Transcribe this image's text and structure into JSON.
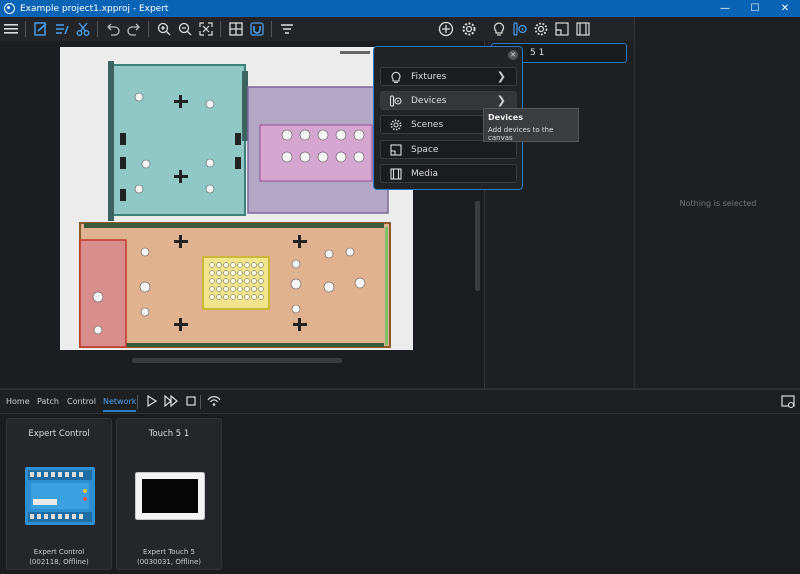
{
  "window": {
    "title": "Example project1.xpproj - Expert"
  },
  "canvas_panel": {
    "nothing_selected": "Nothing is selected"
  },
  "search": {
    "value": "5 1"
  },
  "add_menu": {
    "items": [
      {
        "label": "Fixtures",
        "icon": "bulb-icon"
      },
      {
        "label": "Devices",
        "icon": "device-icon"
      },
      {
        "label": "Scenes",
        "icon": "scene-icon"
      },
      {
        "label": "Space",
        "icon": "space-icon"
      },
      {
        "label": "Media",
        "icon": "film-icon"
      }
    ]
  },
  "tooltip": {
    "title": "Devices",
    "description": "Add devices to the canvas"
  },
  "tabs": [
    {
      "label": "Home"
    },
    {
      "label": "Patch"
    },
    {
      "label": "Control"
    },
    {
      "label": "Network",
      "active": true
    }
  ],
  "devices": [
    {
      "title": "Expert Control",
      "name": "Expert Control",
      "info": "(002118, Offline)"
    },
    {
      "title": "Touch 5 1",
      "name": "Expert Touch 5",
      "info": "(0030031, Offline)"
    }
  ],
  "colors": {
    "accent": "#2b79c2",
    "titlebar": "#0a64b5"
  }
}
